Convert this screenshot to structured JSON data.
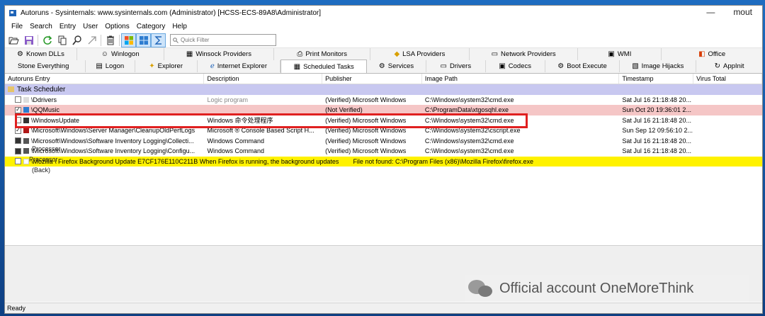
{
  "window": {
    "title": "Autoruns - Sysinternals: www.sysinternals.com (Administrator) [HCSS-ECS-89A8\\Administrator]",
    "corner_text": "mout"
  },
  "menu": [
    "File",
    "Search",
    "Entry",
    "User",
    "Options",
    "Category",
    "Help"
  ],
  "toolbar": {
    "filter_placeholder": "Quick Filter",
    "icons": [
      "open-icon",
      "save-icon",
      "refresh-icon",
      "copy-icon",
      "find-icon",
      "jump-icon",
      "delete-icon",
      "windows-entries-icon",
      "microsoft-entries-icon",
      "sigma-icon"
    ]
  },
  "tabs": {
    "row1": [
      {
        "label": "Known DLLs",
        "icon": "dll-icon"
      },
      {
        "label": "Winlogon",
        "icon": "winlogon-icon"
      },
      {
        "label": "Winsock Providers",
        "icon": "winsock-icon"
      },
      {
        "label": "Print Monitors",
        "icon": "printer-icon"
      },
      {
        "label": "LSA Providers",
        "icon": "shield-icon"
      },
      {
        "label": "Network Providers",
        "icon": "network-icon"
      },
      {
        "label": "WMI",
        "icon": "wmi-icon"
      },
      {
        "label": "Office",
        "icon": "office-icon"
      }
    ],
    "row2": [
      {
        "label": "Stone Everything",
        "icon": ""
      },
      {
        "label": "Logon",
        "icon": "logon-icon"
      },
      {
        "label": "Explorer",
        "icon": "explorer-icon"
      },
      {
        "label": "Internet Explorer",
        "icon": "ie-icon"
      },
      {
        "label": "Scheduled Tasks",
        "icon": "",
        "active": true
      },
      {
        "label": "Services",
        "icon": "services-icon"
      },
      {
        "label": "Drivers",
        "icon": "drivers-icon"
      },
      {
        "label": "Codecs",
        "icon": "codecs-icon"
      },
      {
        "label": "Boot Execute",
        "icon": "boot-icon"
      },
      {
        "label": "Image Hijacks",
        "icon": "hijack-icon"
      },
      {
        "label": "AppInit",
        "icon": "appinit-icon"
      }
    ]
  },
  "columns": [
    "Autoruns Entry",
    "Description",
    "Publisher",
    "Image Path",
    "Timestamp",
    "Virus Total"
  ],
  "group": "Task Scheduler",
  "rows": [
    {
      "checked": false,
      "entry": "\\Ddrivers",
      "description": "Logic program",
      "publisher": "(Verified) Microsoft Windows",
      "image_path": "C:\\Windows\\system32\\cmd.exe",
      "timestamp": "Sat Jul 16 21:18:48 20...",
      "style": ""
    },
    {
      "checked": true,
      "entry": "\\QQMusic",
      "description": "",
      "publisher": "(Not Verified)",
      "image_path": "C:\\ProgramData\\xtgosqhl.exe",
      "timestamp": "Sun Oct 20 19:36:01 2...",
      "style": "red"
    },
    {
      "checked": false,
      "entry": "\\WindowsUpdate",
      "description": "Windows 命令处理程序",
      "publisher": "(Verified) Microsoft Windows",
      "image_path": "C:\\Windows\\system32\\cmd.exe",
      "timestamp": "Sat Jul 16 21:18:48 20...",
      "style": ""
    },
    {
      "checked": true,
      "entry": "\\Microsoft\\Windows\\Server Manager\\CleanupOldPerfLogs",
      "description": "Microsoft ® Console Based Script H...",
      "publisher": "(Verified) Microsoft Windows",
      "image_path": "C:\\Windows\\system32\\cscript.exe",
      "timestamp": "Sun Sep 12 09:56:10 2...",
      "style": ""
    },
    {
      "checked": false,
      "entry": "\\Microsoft\\Windows\\Software Inventory Logging\\Collecti...",
      "description": "Windows Command",
      "publisher": "(Verified) Microsoft Windows",
      "image_path": "C:\\Windows\\system32\\cmd.exe",
      "timestamp": "Sat Jul 16 21:18:48 20...",
      "style": ""
    },
    {
      "checked": false,
      "entry": "\\Microsoft\\Windows\\Software Inventory Logging\\Configu...",
      "description": "Windows Command",
      "publisher": "(Verified) Microsoft Windows",
      "image_path": "C:\\Windows\\system32\\cmd.exe",
      "timestamp": "Sat Jul 16 21:18:48 20...",
      "style": ""
    },
    {
      "checked": false,
      "entry": "\\Mozilla \\ Firefox Background Update E7CF176E110C211B",
      "description": "When Firefox is running, the background updates",
      "publisher": "",
      "image_path": "File not found: C:\\Program Files (x86)\\Mozilla Firefox\\firefox.exe",
      "timestamp": "",
      "style": "yellow"
    }
  ],
  "overlay_labels": [
    "Processor",
    "Processor",
    "(Back)"
  ],
  "status": "Ready",
  "watermark": "Official account OneMoreThink"
}
